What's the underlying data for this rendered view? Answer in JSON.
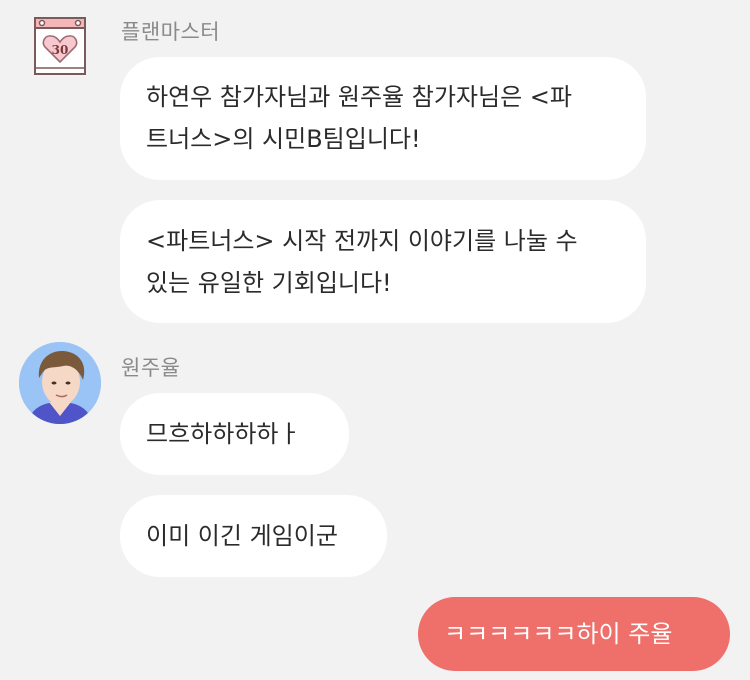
{
  "messages": [
    {
      "sender": "플랜마스터",
      "avatar": "calendar-heart-icon",
      "avatar_text": "30",
      "bubbles": [
        {
          "lines": [
            "하연우 참가자님과 원주율 참가자님은 <파",
            "트너스>의 시민B팀입니다!"
          ]
        },
        {
          "lines": [
            "<파트너스> 시작 전까지 이야기를 나눌 수",
            "있는 유일한 기회입니다!"
          ]
        }
      ]
    },
    {
      "sender": "원주율",
      "avatar": "person-avatar",
      "bubbles": [
        {
          "lines": [
            "므흐하하하하ㅏ"
          ]
        },
        {
          "lines": [
            "이미 이긴 게임이군"
          ]
        }
      ]
    },
    {
      "sender": "me",
      "bubbles": [
        {
          "lines": [
            "ㅋㅋㅋㅋㅋㅋ하이 주율"
          ]
        }
      ]
    }
  ],
  "colors": {
    "background": "#f2f2f2",
    "bubble_other": "#ffffff",
    "bubble_mine": "#ef6f6a",
    "sender_name": "#8a8a8a"
  }
}
